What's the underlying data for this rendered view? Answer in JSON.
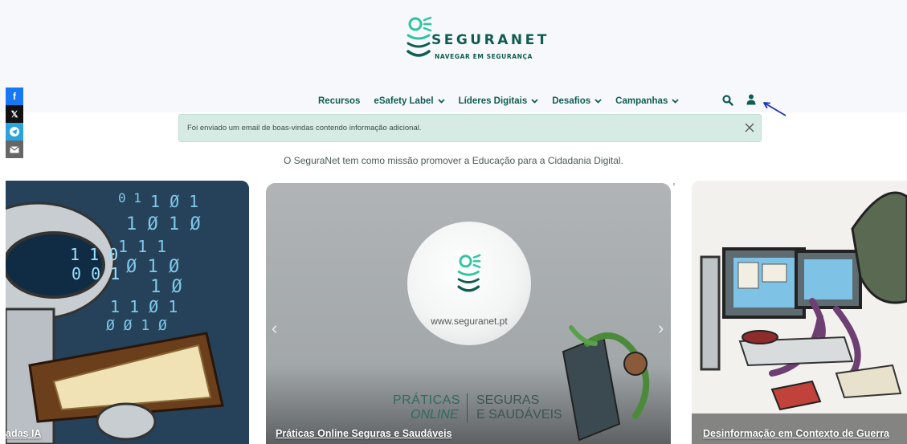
{
  "logo": {
    "title": "SEGURANET",
    "tagline": "NAVEGAR EM SEGURANÇA"
  },
  "nav": {
    "items": [
      {
        "label": "Recursos",
        "has_dropdown": false
      },
      {
        "label": "eSafety Label",
        "has_dropdown": true
      },
      {
        "label": "Líderes Digitais",
        "has_dropdown": true
      },
      {
        "label": "Desafios",
        "has_dropdown": true
      },
      {
        "label": "Campanhas",
        "has_dropdown": true
      }
    ],
    "icons": [
      "search-icon",
      "user-icon"
    ]
  },
  "share": [
    "facebook-icon",
    "x-icon",
    "telegram-icon",
    "email-icon"
  ],
  "alert": {
    "message": "Foi enviado um email de boas-vindas contendo informação adicional.",
    "close_icon": "close-icon"
  },
  "mission": "O SeguraNet tem como missão promover a Educação para a Cidadania Digital.",
  "carousel": {
    "cards": [
      {
        "title": "adas IA"
      },
      {
        "title": "Práticas Online Seguras e Saudáveis",
        "image_text": {
          "url": "www.seguranet.pt",
          "line1a": "PRÁTICAS",
          "line1b": "SEGURAS",
          "line2a": "ONLINE",
          "line2b": "E SAUDÁVEIS"
        }
      },
      {
        "title": "Desinformação em Contexto de Guerra"
      }
    ],
    "prev_icon": "chevron-left-icon",
    "next_icon": "chevron-right-icon"
  },
  "colors": {
    "brand": "#0f5c52",
    "alert_bg": "#d6ebe3",
    "arrow": "#1a33b0"
  }
}
